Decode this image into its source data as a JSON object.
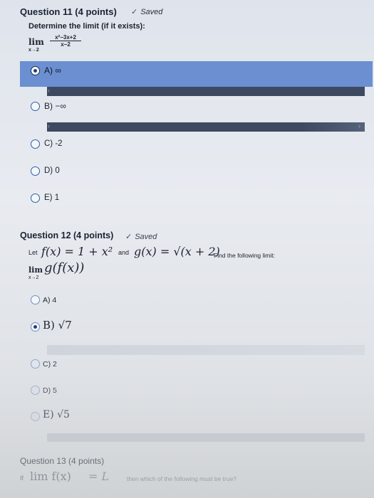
{
  "q11": {
    "title": "Question 11 (4 points)",
    "saved": "Saved",
    "prompt": "Determine the limit (if it exists):",
    "lim_word": "lim",
    "lim_sub": "x→2",
    "numerator": "x²−3x+2",
    "denominator": "x−2",
    "options": [
      {
        "label": "A) ∞",
        "selected": true
      },
      {
        "label": "B) −∞",
        "selected": false
      },
      {
        "label": "C) -2",
        "selected": false
      },
      {
        "label": "D) 0",
        "selected": false
      },
      {
        "label": "E) 1",
        "selected": false
      }
    ]
  },
  "q12": {
    "title": "Question 12 (4 points)",
    "saved": "Saved",
    "let": "Let",
    "f_def": "f(x) = 1 + x²",
    "and": "and",
    "g_def": "g(x) = √(x + 2)",
    "instruction": "Find the following limit:",
    "lim_expr": "g(f(x))",
    "lim_word": "lim",
    "lim_sub": "x→2",
    "options": [
      {
        "label": "A) 4",
        "selected": false
      },
      {
        "label": "B) √7",
        "selected": true
      },
      {
        "label": "C) 2",
        "selected": false
      },
      {
        "label": "D) 5",
        "selected": false
      },
      {
        "label": "E) √5",
        "selected": false
      }
    ]
  },
  "q13": {
    "title": "Question 13 (4 points)",
    "text_if": "If",
    "lim_expr": "lim f(x)",
    "eq": "= L",
    "text_rest": "then which of the following must be true?"
  },
  "colors": {
    "selected_highlight": "#6b8fd0",
    "scrollbar": "#3c4960",
    "radio_border": "#2c5fa8"
  }
}
